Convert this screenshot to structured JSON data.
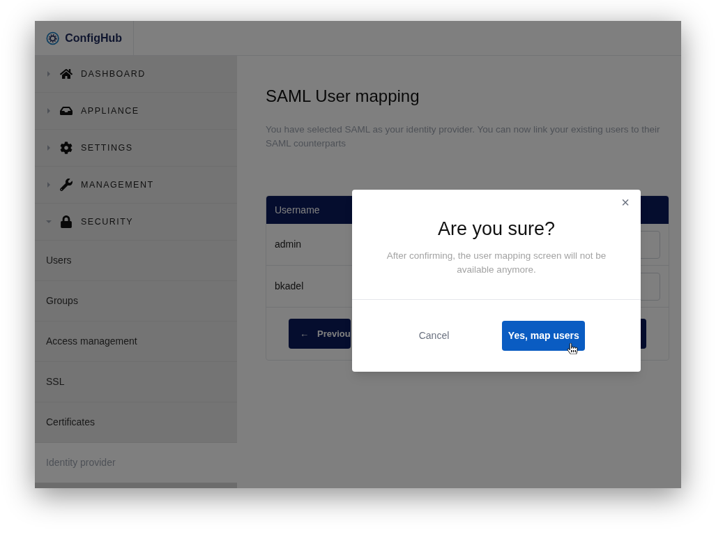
{
  "brand": {
    "name": "ConfigHub"
  },
  "sidebar": {
    "sections": [
      {
        "label": "DASHBOARD",
        "expanded": false
      },
      {
        "label": "APPLIANCE",
        "expanded": false
      },
      {
        "label": "SETTINGS",
        "expanded": false
      },
      {
        "label": "MANAGEMENT",
        "expanded": false
      },
      {
        "label": "SECURITY",
        "expanded": true,
        "children": [
          {
            "label": "Users",
            "selected": false
          },
          {
            "label": "Groups",
            "selected": false
          },
          {
            "label": "Access management",
            "selected": false
          },
          {
            "label": "SSL",
            "selected": false
          },
          {
            "label": "Certificates",
            "selected": false
          },
          {
            "label": "Identity provider",
            "selected": true
          }
        ]
      }
    ]
  },
  "page": {
    "title": "SAML User mapping",
    "description": "You have selected SAML as your identity provider. You can now link your existing users to their SAML counterparts"
  },
  "table": {
    "columns": [
      "Username"
    ],
    "rows": [
      {
        "username": "admin"
      },
      {
        "username": "bkadel"
      }
    ]
  },
  "previous_button": {
    "icon": "←",
    "label": "Previou"
  },
  "modal": {
    "close": "×",
    "title": "Are you sure?",
    "message": "After confirming, the user mapping screen will not be available anymore.",
    "cancel": "Cancel",
    "confirm": "Yes, map users"
  }
}
